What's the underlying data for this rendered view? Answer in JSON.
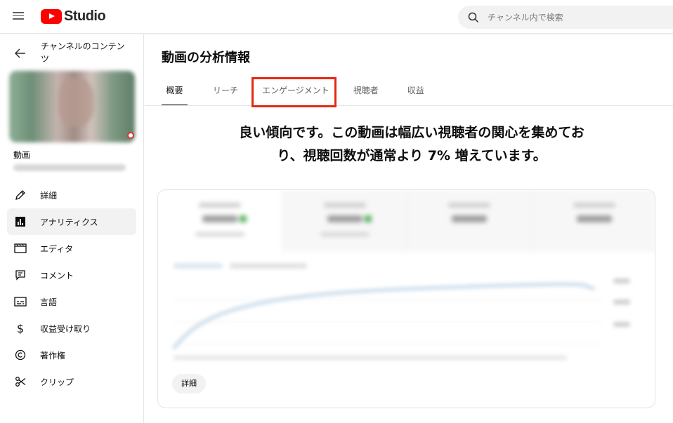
{
  "app": {
    "brand": "Studio",
    "brand_color": "#ff0000"
  },
  "search": {
    "placeholder": "チャンネル内で検索"
  },
  "sidebar": {
    "back_label": "チャンネルのコンテンツ",
    "video_label": "動画",
    "items": [
      {
        "label": "詳細",
        "icon": "pencil-icon",
        "active": false
      },
      {
        "label": "アナリティクス",
        "icon": "analytics-icon",
        "active": true
      },
      {
        "label": "エディタ",
        "icon": "editor-icon",
        "active": false
      },
      {
        "label": "コメント",
        "icon": "comment-icon",
        "active": false
      },
      {
        "label": "言語",
        "icon": "subtitles-icon",
        "active": false
      },
      {
        "label": "収益受け取り",
        "icon": "dollar-icon",
        "active": false
      },
      {
        "label": "著作権",
        "icon": "copyright-icon",
        "active": false
      },
      {
        "label": "クリップ",
        "icon": "scissors-icon",
        "active": false
      }
    ]
  },
  "main": {
    "title": "動画の分析情報",
    "tabs": [
      {
        "label": "概要",
        "active": true
      },
      {
        "label": "リーチ",
        "active": false
      },
      {
        "label": "エンゲージメント",
        "active": false,
        "highlighted": true
      },
      {
        "label": "視聴者",
        "active": false
      },
      {
        "label": "収益",
        "active": false
      }
    ],
    "headline_line1": "良い傾向です。この動画は幅広い視聴者の関心を集めてお",
    "headline_line2": "り、視聴回数が通常より 7% 増えています。",
    "detail_button": "詳細",
    "highlight_color": "#e52910"
  }
}
